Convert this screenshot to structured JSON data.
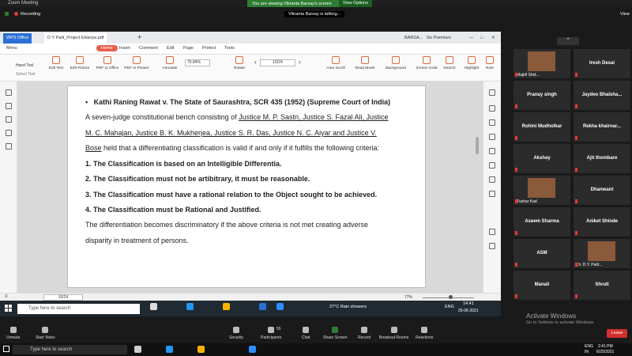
{
  "zoom_window": {
    "title": "Zoom Meeting",
    "share_banner": "You are viewing Vikranta Barsay's screen",
    "view_options": "View Options",
    "recording": "Recording",
    "view": "View",
    "talking": "Vikranta Barsay is talking..."
  },
  "wps": {
    "tabs": [
      "WPS Office",
      "D Y Patil_Project Eklavya.pdf"
    ],
    "account": "BARSA...",
    "premium": "Go Premium",
    "menu": [
      "Menu",
      "Home",
      "Insert",
      "Comment",
      "Edit",
      "Page",
      "Protect",
      "Tools"
    ],
    "tools_left": [
      "Hand Tool",
      "Select Tool"
    ],
    "tools": [
      "Edit Text",
      "Edit Picture",
      "PDF to Office",
      "PDF to Picture",
      "Annotate",
      "Rotate",
      "Auto Scroll",
      "Read Mode",
      "Background",
      "Screen Grab",
      "Search",
      "Highlight",
      "Note"
    ],
    "zoom": "76.84%",
    "page": "10/24",
    "status_page": "10/24",
    "status_zoom": "77%"
  },
  "document": {
    "heading_bullet": "•",
    "heading": "Kathi Raning Rawat v. The State of Saurashtra, SCR 435 (1952) (Supreme Court of India)",
    "line1_plain": "A seven-judge constitutional bench consisting of ",
    "line1_u": "Justice M. P. Sastri, Justice S. Fazal Ali, Justice",
    "line2_u": "M. C. Mahajan, Justice B. K. Mukherjea, Justice S. R. Das, Justice N. C. Aiyar and Justice V.",
    "line3_u": "Bose",
    "line3_plain": " held that a differentiating classification is valid if and only if it fulfills the following criteria:",
    "c1": "1.  The Classification is based on an Intelligible Differentia.",
    "c2": "2.  The Classification must not be artibitrary, it must be reasonable.",
    "c3": "3.  The Classification must have a rational relation to the Object sought to be achieved.",
    "c4": "4.  The Classification must be Rational and Justified.",
    "p1": "The differentiation becomes discriminatory if the above criteria is not met creating adverse",
    "p2": "disparity in treatment of persons."
  },
  "win_taskbar": {
    "search": "Type here to search",
    "weather": "27°C  Rain showers",
    "lang": "ENG",
    "time": "14:41",
    "date": "25-06-2021"
  },
  "participants": [
    {
      "name": "Majidl Shid...",
      "has_video": true
    },
    {
      "name": "Iresh Desai",
      "has_video": false
    },
    {
      "name": "Pranay singh",
      "has_video": false
    },
    {
      "name": "Jaydeo  Bhalsha...",
      "has_video": false
    },
    {
      "name": "Rohini Mudholkar",
      "has_video": false
    },
    {
      "name": "Rekha  khairnar...",
      "has_video": false
    },
    {
      "name": "Akshay",
      "has_video": false
    },
    {
      "name": "Ajit thombare",
      "has_video": false
    },
    {
      "name": "Tushar Kad",
      "has_video": true
    },
    {
      "name": "Dhanwant",
      "has_video": false
    },
    {
      "name": "Aseem Sharma",
      "has_video": false
    },
    {
      "name": "Aniket Shinde",
      "has_video": false
    },
    {
      "name": "ASM",
      "has_video": false
    },
    {
      "name": "Dr. D.Y. Patil...",
      "has_video": true
    },
    {
      "name": "Manali",
      "has_video": false
    },
    {
      "name": "Shruti",
      "has_video": false
    }
  ],
  "activate": {
    "title": "Activate Windows",
    "subtitle": "Go to Settings to activate Windows."
  },
  "zoom_controls": {
    "unmute": "Unmute",
    "start_video": "Start Video",
    "security": "Security",
    "participants": "Participants",
    "participants_count": "55",
    "chat": "Chat",
    "share": "Share Screen",
    "record": "Record",
    "breakout": "Breakout Rooms",
    "reactions": "Reactions",
    "leave": "Leave"
  },
  "os_taskbar": {
    "search": "Type here to search",
    "lang": "ENG",
    "region": "IN",
    "time": "2:41 PM",
    "date": "6/25/2021"
  }
}
